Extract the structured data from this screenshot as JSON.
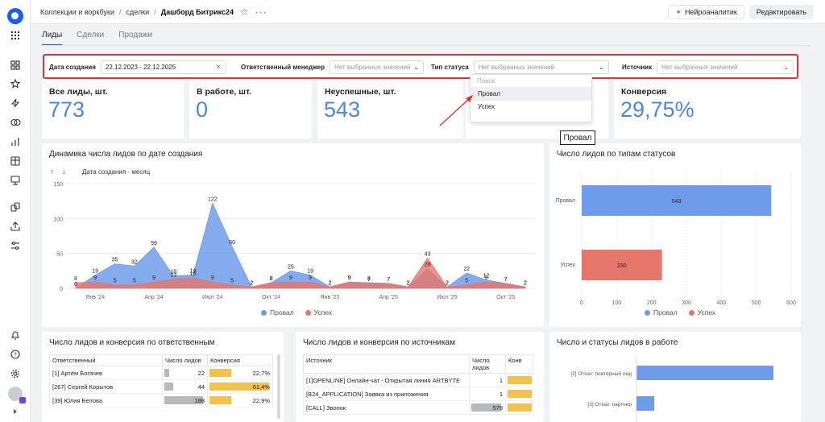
{
  "breadcrumbs": [
    "Коллекции и воркбуки",
    "сделки",
    "Дашборд Битрикс24"
  ],
  "topbar": {
    "neuro_label": "Нейроаналитик",
    "edit_label": "Редактировать"
  },
  "tabs": [
    "Лиды",
    "Сделки",
    "Продажи"
  ],
  "filters": {
    "date": {
      "label": "Дата создания",
      "value": "22.12.2023 - 22.12.2025"
    },
    "manager": {
      "label": "Ответственный менеджер",
      "placeholder": "Нет выбранных значений"
    },
    "status_type": {
      "label": "Тип статуса",
      "placeholder": "Нет выбранных значений"
    },
    "source": {
      "label": "Источник",
      "placeholder": "Нет выбранных значений"
    }
  },
  "dropdown": {
    "search_placeholder": "Поиск",
    "options": [
      "Провал",
      "Успех"
    ],
    "tooltip": "Провал"
  },
  "kpis": [
    {
      "label": "Все лиды, шт.",
      "value": "773"
    },
    {
      "label": "В работе, шт.",
      "value": "0"
    },
    {
      "label": "Неуспешные, шт.",
      "value": "543"
    },
    {
      "label": "Конверсия",
      "value": "29,75%"
    }
  ],
  "area_chart_title": "Динамика числа лидов по дате создания",
  "area_chart_sort_label": "Дата создания · месяц",
  "bar_chart_title": "Число лидов по типам статусов",
  "colors": {
    "fail": "#6f9cea",
    "success": "#e7776a",
    "accent": "#1a5cff"
  },
  "legend": {
    "fail": "Провал",
    "success": "Успех"
  },
  "chart_data": [
    {
      "type": "area",
      "title": "Динамика числа лидов по дате создания",
      "xlabel": "Дата создания · месяц",
      "x_ticks": [
        "Янв '24",
        "Апр '24",
        "Июл '24",
        "Окт '24",
        "Янв '25",
        "Апр '25",
        "Июл '25",
        "Окт '25"
      ],
      "yticks": [
        0,
        50,
        100,
        150
      ],
      "ylim": [
        0,
        150
      ],
      "series": [
        {
          "name": "Провал",
          "values": [
            0,
            19,
            35,
            32,
            59,
            18,
            19,
            122,
            60,
            2,
            8,
            25,
            19,
            2,
            9,
            8,
            7,
            2,
            28,
            2,
            22,
            12,
            7,
            2
          ]
        },
        {
          "name": "Успех",
          "values": [
            8,
            9,
            5,
            5,
            9,
            13,
            15,
            9,
            5,
            2,
            8,
            9,
            9,
            2,
            9,
            7,
            7,
            2,
            43,
            2,
            5,
            9,
            7,
            2
          ]
        }
      ]
    },
    {
      "type": "bar",
      "title": "Число лидов по типам статусов",
      "categories": [
        "Провал",
        "Успех"
      ],
      "values": [
        543,
        230
      ],
      "xticks": [
        0,
        100,
        200,
        300,
        400,
        500,
        600
      ],
      "xlim": [
        0,
        600
      ]
    },
    {
      "type": "bar",
      "title": "Число и статусы лидов в работе",
      "categories": [
        "[2] Отказ: повторный лид",
        "[3] Отказ: партнер"
      ],
      "values": [
        100,
        13
      ]
    }
  ],
  "table_managers": {
    "title": "Число лидов и конверсия по ответственным",
    "headers": [
      "Ответственный",
      "Число лидов",
      "Конверсия"
    ],
    "rows": [
      {
        "name": "[1] Артём Богачев",
        "count": "22",
        "conv": "22,7%",
        "count_frac": 0.12,
        "conv_frac": 0.37
      },
      {
        "name": "[267] Сергей Корытов",
        "count": "44",
        "conv": "61,4%",
        "count_frac": 0.23,
        "conv_frac": 1.0
      },
      {
        "name": "[39] Юлия Белова",
        "count": "188",
        "conv": "22,9%",
        "count_frac": 1.0,
        "conv_frac": 0.37
      }
    ]
  },
  "table_sources": {
    "title": "Число лидов и конверсия по источникам",
    "headers": [
      "Источник",
      "Число лидов",
      "Конв"
    ],
    "rows": [
      {
        "name": "[1]OPENLINE] Онлайн-чат - Открытая линия ARTBYTE",
        "count": "1",
        "count_frac": 0.0
      },
      {
        "name": "[B24_APPLICATION] Заявка из приложения",
        "count": "1",
        "count_frac": 0.0
      },
      {
        "name": "[CALL] Звонок",
        "count": "579",
        "count_frac": 1.0
      }
    ]
  },
  "work_chart_title": "Число и статусы лидов в работе"
}
